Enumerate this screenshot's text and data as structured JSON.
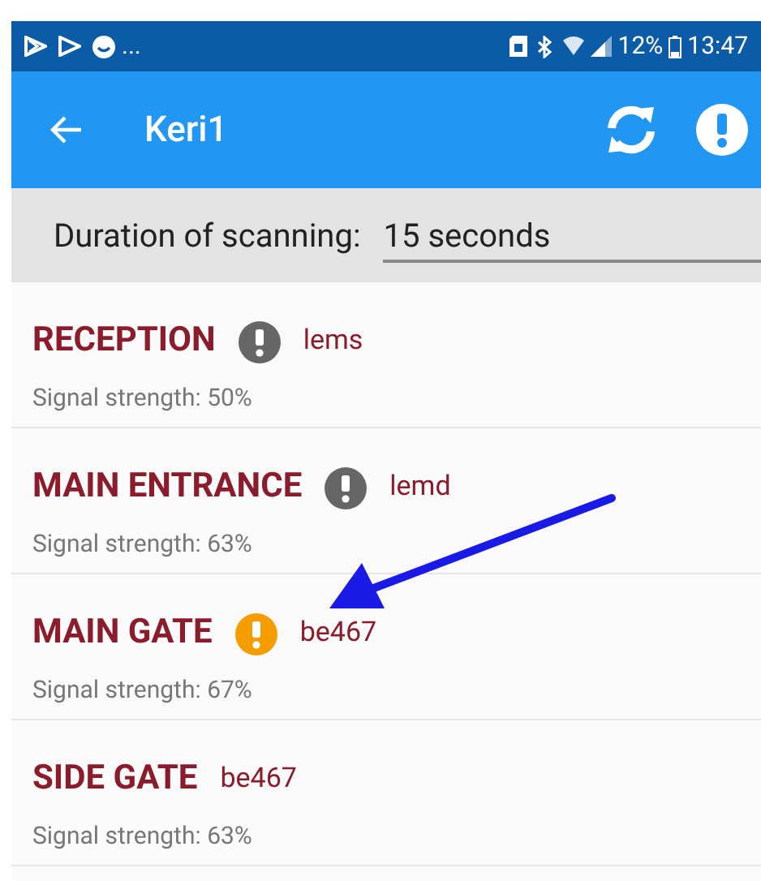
{
  "status_bar": {
    "notifications_more": "...",
    "battery": "12%",
    "time": "13:47"
  },
  "app_bar": {
    "title": "Keri1"
  },
  "scanning": {
    "label": "Duration of scanning:",
    "value": "15 seconds"
  },
  "devices": [
    {
      "name": "RECEPTION",
      "code": "lems",
      "signal": "Signal strength: 50%",
      "color": "#666666"
    },
    {
      "name": "MAIN ENTRANCE",
      "code": "lemd",
      "signal": "Signal strength: 63%",
      "color": "#666666"
    },
    {
      "name": "MAIN GATE",
      "code": "be467",
      "signal": "Signal strength: 67%",
      "color": "#f59c00"
    },
    {
      "name": "SIDE GATE",
      "code": "be467",
      "signal": "Signal strength: 63%"
    }
  ]
}
